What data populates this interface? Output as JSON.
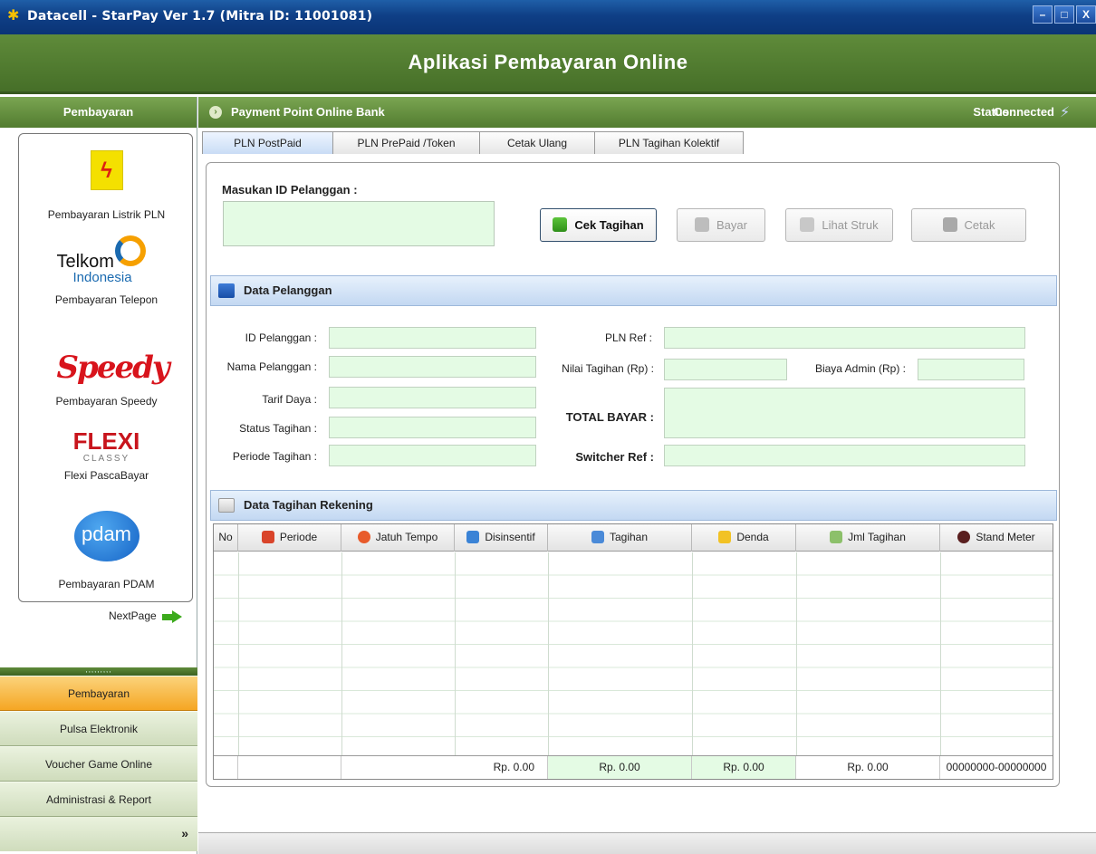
{
  "window": {
    "title": "Datacell - StarPay  Ver 1.7  (Mitra ID: 11001081)",
    "controls": [
      "–",
      "□",
      "X"
    ]
  },
  "app": {
    "title": "Aplikasi Pembayaran Online"
  },
  "sidebar": {
    "header": "Pembayaran",
    "services": [
      {
        "label": "Pembayaran Listrik PLN",
        "icon": "pln-logo"
      },
      {
        "label": "Pembayaran Telepon",
        "icon": "telkom-logo",
        "logo_text_1": "Telkom",
        "logo_text_2": "Indonesia"
      },
      {
        "label": "Pembayaran Speedy",
        "icon": "speedy-logo",
        "logo_text": "Speedy"
      },
      {
        "label": "Flexi PascaBayar",
        "icon": "flexi-logo",
        "logo_text": "FLEXI",
        "logo_sub": "CLASSY"
      },
      {
        "label": "Pembayaran PDAM",
        "icon": "pdam-logo",
        "logo_text": "pdam"
      }
    ],
    "next_page": "NextPage",
    "grip": ",,,,,,,,,",
    "menu": [
      {
        "label": "Pembayaran",
        "active": true
      },
      {
        "label": "Pulsa Elektronik",
        "active": false
      },
      {
        "label": "Voucher Game Online",
        "active": false
      },
      {
        "label": "Administrasi & Report",
        "active": false
      }
    ],
    "more": "»"
  },
  "main": {
    "header_title": "Payment Point Online Bank",
    "status_label": "Status :",
    "status_value": "Connected",
    "tabs": [
      {
        "label": "PLN PostPaid",
        "active": true
      },
      {
        "label": "PLN PrePaid /Token",
        "active": false
      },
      {
        "label": "Cetak Ulang",
        "active": false
      },
      {
        "label": "PLN Tagihan Kolektif",
        "active": false
      }
    ],
    "id_prompt": "Masukan ID Pelanggan :",
    "id_value": "",
    "buttons": {
      "cek": "Cek Tagihan",
      "bayar": "Bayar",
      "lihat": "Lihat Struk",
      "cetak": "Cetak"
    },
    "section_customer": "Data Pelanggan",
    "fields": {
      "id_pelanggan": "ID Pelanggan :",
      "nama_pelanggan": "Nama Pelanggan :",
      "tarif_daya": "Tarif Daya :",
      "status_tagihan": "Status Tagihan :",
      "periode_tagihan": "Periode Tagihan :",
      "pln_ref": "PLN Ref :",
      "nilai_tagihan": "Nilai Tagihan (Rp) :",
      "biaya_admin": "Biaya Admin (Rp) :",
      "total_bayar": "TOTAL BAYAR :",
      "switcher_ref": "Switcher Ref :"
    },
    "section_bills": "Data Tagihan Rekening",
    "table": {
      "columns": [
        "No",
        "Periode",
        "Jatuh Tempo",
        "Disinsentif",
        "Tagihan",
        "Denda",
        "Jml Tagihan",
        "Stand Meter"
      ],
      "footer": [
        "",
        "",
        "Rp. 0.00",
        "Rp. 0.00",
        "Rp. 0.00",
        "Rp. 0.00",
        "00000000-00000000"
      ]
    }
  },
  "colors": {
    "header_green": "#527c30",
    "field_green": "#e4fbe4",
    "active_orange": "#f5a623",
    "title_blue": "#0f3f86"
  }
}
